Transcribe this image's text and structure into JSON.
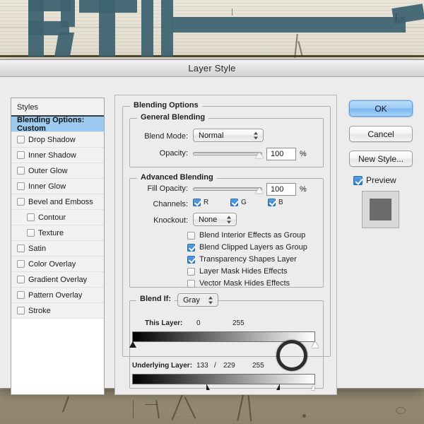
{
  "background": {
    "description": "weathered painted wood sign",
    "paint_color": "#3c6270",
    "wood_color": "#cfc8b4",
    "letters": "RTI"
  },
  "dialog": {
    "title": "Layer Style"
  },
  "styles_list": {
    "header": "Styles",
    "items": [
      {
        "label": "Blending Options: Custom",
        "checkbox": false,
        "selected": true,
        "indent": false
      },
      {
        "label": "Drop Shadow",
        "checkbox": true,
        "checked": false,
        "selected": false,
        "indent": false
      },
      {
        "label": "Inner Shadow",
        "checkbox": true,
        "checked": false,
        "selected": false,
        "indent": false
      },
      {
        "label": "Outer Glow",
        "checkbox": true,
        "checked": false,
        "selected": false,
        "indent": false
      },
      {
        "label": "Inner Glow",
        "checkbox": true,
        "checked": false,
        "selected": false,
        "indent": false
      },
      {
        "label": "Bevel and Emboss",
        "checkbox": true,
        "checked": false,
        "selected": false,
        "indent": false
      },
      {
        "label": "Contour",
        "checkbox": true,
        "checked": false,
        "selected": false,
        "indent": true
      },
      {
        "label": "Texture",
        "checkbox": true,
        "checked": false,
        "selected": false,
        "indent": true
      },
      {
        "label": "Satin",
        "checkbox": true,
        "checked": false,
        "selected": false,
        "indent": false
      },
      {
        "label": "Color Overlay",
        "checkbox": true,
        "checked": false,
        "selected": false,
        "indent": false
      },
      {
        "label": "Gradient Overlay",
        "checkbox": true,
        "checked": false,
        "selected": false,
        "indent": false
      },
      {
        "label": "Pattern Overlay",
        "checkbox": true,
        "checked": false,
        "selected": false,
        "indent": false
      },
      {
        "label": "Stroke",
        "checkbox": true,
        "checked": false,
        "selected": false,
        "indent": false
      }
    ]
  },
  "blending_options": {
    "group_label": "Blending Options",
    "general": {
      "group_label": "General Blending",
      "blend_mode_label": "Blend Mode:",
      "blend_mode_value": "Normal",
      "opacity_label": "Opacity:",
      "opacity_value": "100",
      "opacity_unit": "%"
    },
    "advanced": {
      "group_label": "Advanced Blending",
      "fill_opacity_label": "Fill Opacity:",
      "fill_opacity_value": "100",
      "fill_opacity_unit": "%",
      "channels_label": "Channels:",
      "channels": [
        {
          "label": "R",
          "checked": true
        },
        {
          "label": "G",
          "checked": true
        },
        {
          "label": "B",
          "checked": true
        }
      ],
      "knockout_label": "Knockout:",
      "knockout_value": "None",
      "options": [
        {
          "label": "Blend Interior Effects as Group",
          "checked": false
        },
        {
          "label": "Blend Clipped Layers as Group",
          "checked": true
        },
        {
          "label": "Transparency Shapes Layer",
          "checked": true
        },
        {
          "label": "Layer Mask Hides Effects",
          "checked": false
        },
        {
          "label": "Vector Mask Hides Effects",
          "checked": false
        }
      ]
    },
    "blend_if": {
      "group_label": "Blend If:",
      "channel_value": "Gray",
      "this_layer": {
        "label": "This Layer:",
        "low": "0",
        "high": "255"
      },
      "underlying_layer": {
        "label": "Underlying Layer:",
        "low_a": "133",
        "separator": "/",
        "low_b": "229",
        "high": "255"
      }
    }
  },
  "buttons": {
    "ok": "OK",
    "cancel": "Cancel",
    "new_style": "New Style...",
    "preview_label": "Preview",
    "preview_checked": true
  }
}
